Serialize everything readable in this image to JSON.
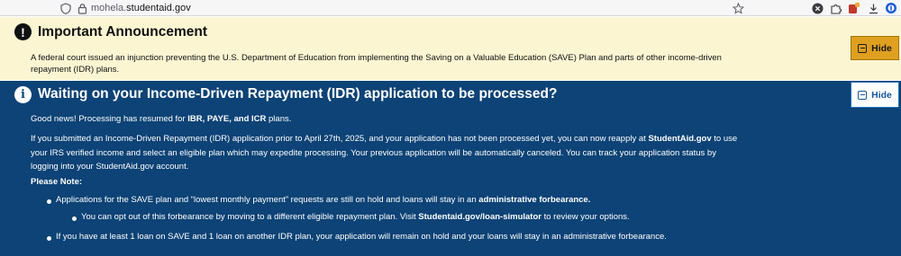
{
  "browser": {
    "url_prefix": "mohela.",
    "url_domain": "studentaid.gov",
    "icons": [
      "shield-icon",
      "lock-icon",
      "star-icon",
      "close-circle-icon",
      "extension-icon",
      "red-extension-icon",
      "download-icon",
      "password-manager-icon"
    ]
  },
  "announcement": {
    "title": "Important Announcement",
    "body": "A federal court issued an injunction preventing the U.S. Department of Education from implementing the Saving on a Valuable Education (SAVE) Plan and parts of other income-driven repayment (IDR) plans.",
    "hide_label": "Hide",
    "bg_color": "#fcf5d2",
    "button_color": "#dfa020"
  },
  "idr_notice": {
    "title": "Waiting on your Income-Driven Repayment (IDR) application to be processed?",
    "hide_label": "Hide",
    "bg_color": "#0d4376",
    "good_news_pre": "Good news! Processing has resumed for ",
    "good_news_bold": "IBR, PAYE, and ICR",
    "good_news_post": " plans.",
    "para2_pre": "If you submitted an Income-Driven Repayment (IDR) application prior to April 27th, 2025, and your application has not been processed yet, you can now reapply at ",
    "para2_bold": "StudentAid.gov",
    "para2_post": " to use your IRS verified income and select an eligible plan which may expedite processing. Your previous application will be automatically canceled. You can track your application status by logging into your StudentAid.gov account.",
    "please_note": "Please Note:",
    "bullet1_pre": "Applications for the SAVE plan and “lowest monthly payment” requests are still on hold and loans will stay in an ",
    "bullet1_bold": "administrative forbearance.",
    "sub_bullet_pre": "You can opt out of this forbearance by moving to a different eligible repayment plan. Visit ",
    "sub_bullet_bold": "Studentaid.gov/loan-simulator",
    "sub_bullet_post": " to review your options.",
    "bullet2": "If you have at least 1 loan on SAVE and 1 loan on another IDR plan, your application will remain on hold and your loans will stay in an administrative forbearance."
  }
}
